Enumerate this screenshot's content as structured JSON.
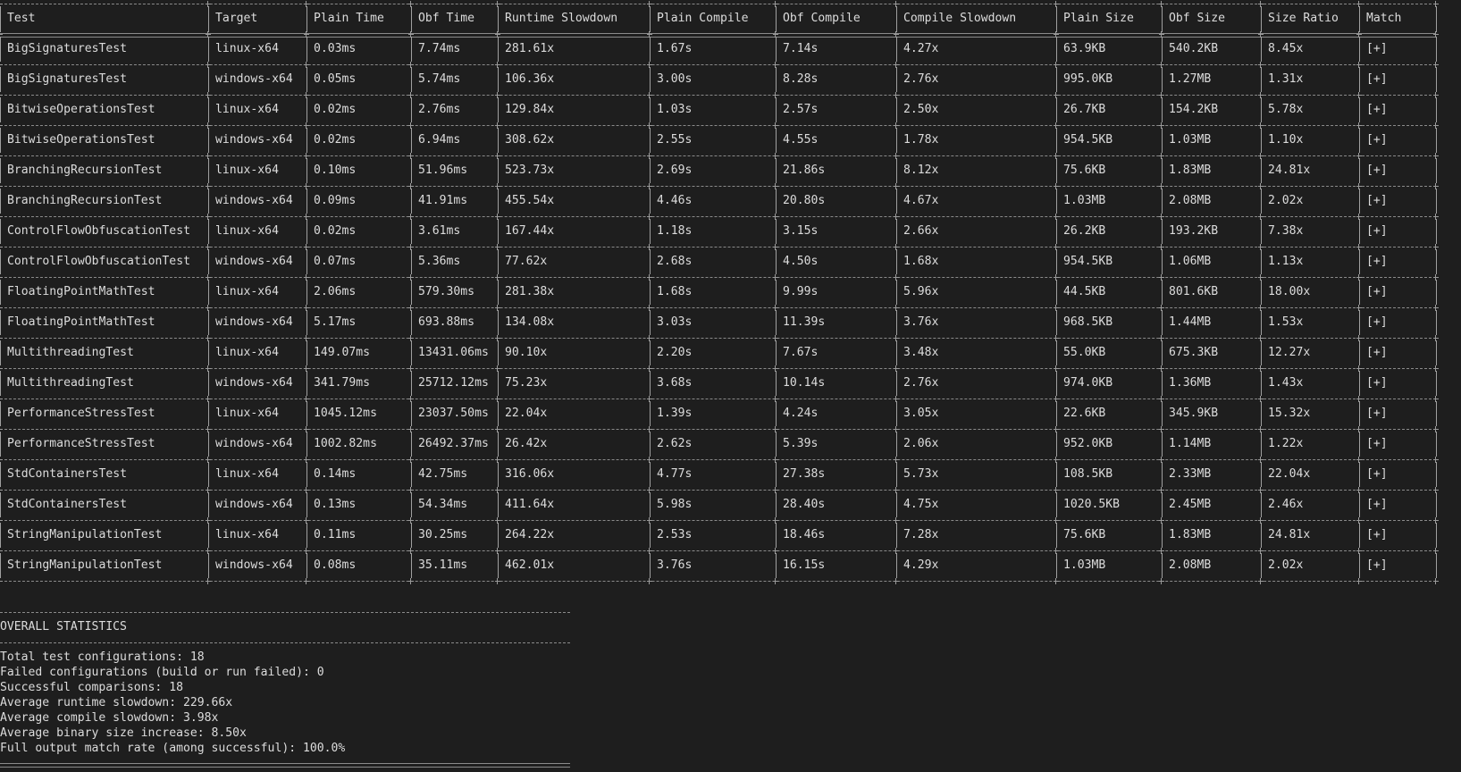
{
  "table": {
    "columns": [
      "Test",
      "Target",
      "Plain Time",
      "Obf Time",
      "Runtime Slowdown",
      "Plain Compile",
      "Obf Compile",
      "Compile Slowdown",
      "Plain Size",
      "Obf Size",
      "Size Ratio",
      "Match"
    ],
    "rows": [
      [
        "BigSignaturesTest",
        "linux-x64",
        "0.03ms",
        "7.74ms",
        "281.61x",
        "1.67s",
        "7.14s",
        "4.27x",
        "63.9KB",
        "540.2KB",
        "8.45x",
        "[+]"
      ],
      [
        "BigSignaturesTest",
        "windows-x64",
        "0.05ms",
        "5.74ms",
        "106.36x",
        "3.00s",
        "8.28s",
        "2.76x",
        "995.0KB",
        "1.27MB",
        "1.31x",
        "[+]"
      ],
      [
        "BitwiseOperationsTest",
        "linux-x64",
        "0.02ms",
        "2.76ms",
        "129.84x",
        "1.03s",
        "2.57s",
        "2.50x",
        "26.7KB",
        "154.2KB",
        "5.78x",
        "[+]"
      ],
      [
        "BitwiseOperationsTest",
        "windows-x64",
        "0.02ms",
        "6.94ms",
        "308.62x",
        "2.55s",
        "4.55s",
        "1.78x",
        "954.5KB",
        "1.03MB",
        "1.10x",
        "[+]"
      ],
      [
        "BranchingRecursionTest",
        "linux-x64",
        "0.10ms",
        "51.96ms",
        "523.73x",
        "2.69s",
        "21.86s",
        "8.12x",
        "75.6KB",
        "1.83MB",
        "24.81x",
        "[+]"
      ],
      [
        "BranchingRecursionTest",
        "windows-x64",
        "0.09ms",
        "41.91ms",
        "455.54x",
        "4.46s",
        "20.80s",
        "4.67x",
        "1.03MB",
        "2.08MB",
        "2.02x",
        "[+]"
      ],
      [
        "ControlFlowObfuscationTest",
        "linux-x64",
        "0.02ms",
        "3.61ms",
        "167.44x",
        "1.18s",
        "3.15s",
        "2.66x",
        "26.2KB",
        "193.2KB",
        "7.38x",
        "[+]"
      ],
      [
        "ControlFlowObfuscationTest",
        "windows-x64",
        "0.07ms",
        "5.36ms",
        "77.62x",
        "2.68s",
        "4.50s",
        "1.68x",
        "954.5KB",
        "1.06MB",
        "1.13x",
        "[+]"
      ],
      [
        "FloatingPointMathTest",
        "linux-x64",
        "2.06ms",
        "579.30ms",
        "281.38x",
        "1.68s",
        "9.99s",
        "5.96x",
        "44.5KB",
        "801.6KB",
        "18.00x",
        "[+]"
      ],
      [
        "FloatingPointMathTest",
        "windows-x64",
        "5.17ms",
        "693.88ms",
        "134.08x",
        "3.03s",
        "11.39s",
        "3.76x",
        "968.5KB",
        "1.44MB",
        "1.53x",
        "[+]"
      ],
      [
        "MultithreadingTest",
        "linux-x64",
        "149.07ms",
        "13431.06ms",
        "90.10x",
        "2.20s",
        "7.67s",
        "3.48x",
        "55.0KB",
        "675.3KB",
        "12.27x",
        "[+]"
      ],
      [
        "MultithreadingTest",
        "windows-x64",
        "341.79ms",
        "25712.12ms",
        "75.23x",
        "3.68s",
        "10.14s",
        "2.76x",
        "974.0KB",
        "1.36MB",
        "1.43x",
        "[+]"
      ],
      [
        "PerformanceStressTest",
        "linux-x64",
        "1045.12ms",
        "23037.50ms",
        "22.04x",
        "1.39s",
        "4.24s",
        "3.05x",
        "22.6KB",
        "345.9KB",
        "15.32x",
        "[+]"
      ],
      [
        "PerformanceStressTest",
        "windows-x64",
        "1002.82ms",
        "26492.37ms",
        "26.42x",
        "2.62s",
        "5.39s",
        "2.06x",
        "952.0KB",
        "1.14MB",
        "1.22x",
        "[+]"
      ],
      [
        "StdContainersTest",
        "linux-x64",
        "0.14ms",
        "42.75ms",
        "316.06x",
        "4.77s",
        "27.38s",
        "5.73x",
        "108.5KB",
        "2.33MB",
        "22.04x",
        "[+]"
      ],
      [
        "StdContainersTest",
        "windows-x64",
        "0.13ms",
        "54.34ms",
        "411.64x",
        "5.98s",
        "28.40s",
        "4.75x",
        "1020.5KB",
        "2.45MB",
        "2.46x",
        "[+]"
      ],
      [
        "StringManipulationTest",
        "linux-x64",
        "0.11ms",
        "30.25ms",
        "264.22x",
        "2.53s",
        "18.46s",
        "7.28x",
        "75.6KB",
        "1.83MB",
        "24.81x",
        "[+]"
      ],
      [
        "StringManipulationTest",
        "windows-x64",
        "0.08ms",
        "35.11ms",
        "462.01x",
        "3.76s",
        "16.15s",
        "4.29x",
        "1.03MB",
        "2.08MB",
        "2.02x",
        "[+]"
      ]
    ]
  },
  "stats": {
    "heading": "OVERALL STATISTICS",
    "lines": [
      "Total test configurations: 18",
      "Failed configurations (build or run failed): 0",
      "Successful comparisons: 18",
      "Average runtime slowdown: 229.66x",
      "Average compile slowdown: 3.98x",
      "Average binary size increase: 8.50x",
      "Full output match rate (among successful): 100.0%"
    ]
  }
}
